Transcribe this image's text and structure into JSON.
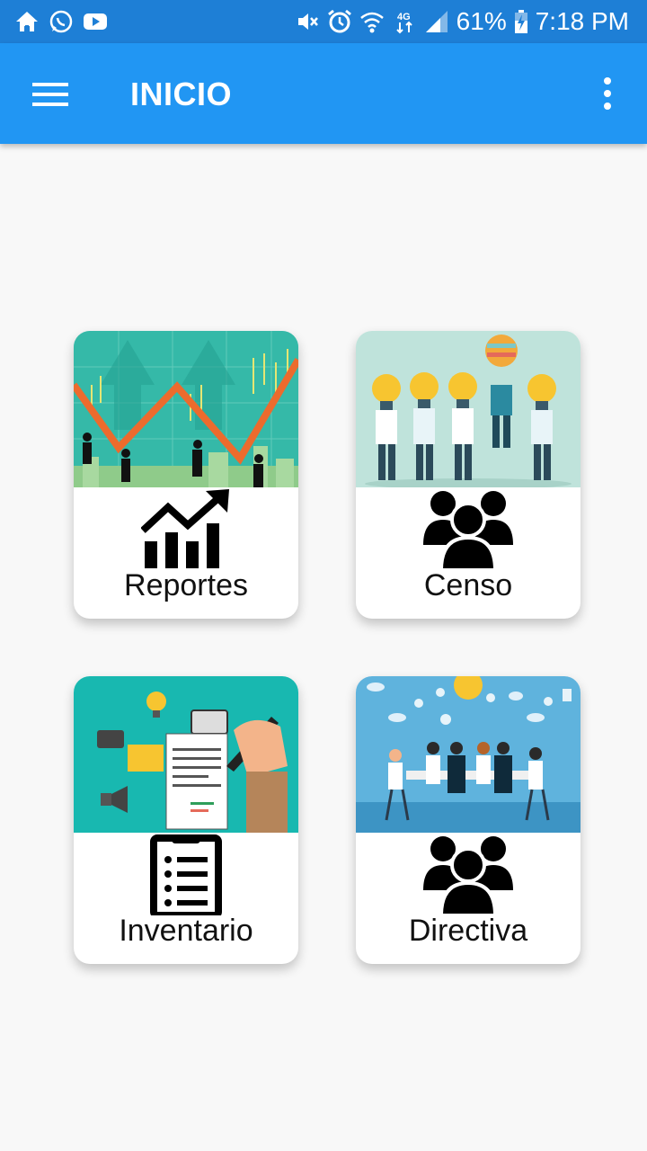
{
  "status_bar": {
    "battery": "61%",
    "time": "7:18 PM",
    "left_icons": [
      "home-icon",
      "whatsapp-icon",
      "youtube-icon"
    ],
    "right_icons": [
      "mute-icon",
      "alarm-icon",
      "wifi-icon",
      "data-icon",
      "signal-icon",
      "battery-icon"
    ]
  },
  "app_bar": {
    "title": "INICIO",
    "color": "#2196f3",
    "menu_icon": "hamburger-menu-icon",
    "overflow_icon": "more-vert-icon"
  },
  "cards": [
    {
      "label": "Reportes",
      "icon": "trending-up-chart-icon",
      "image": "business-people-chart-illustration"
    },
    {
      "label": "Censo",
      "icon": "group-people-icon",
      "image": "people-lightbulbs-illustration"
    },
    {
      "label": "Inventario",
      "icon": "clipboard-list-icon",
      "image": "document-pen-marketing-illustration"
    },
    {
      "label": "Directiva",
      "icon": "group-people-icon",
      "image": "team-meeting-illustration"
    }
  ]
}
